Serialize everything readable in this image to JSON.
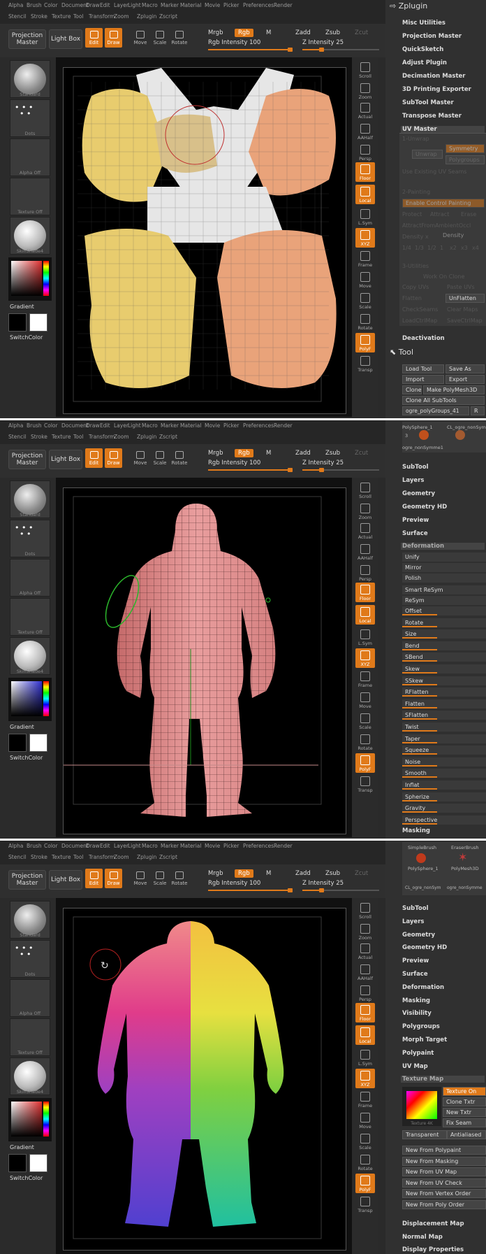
{
  "menu_row1": [
    "Alpha",
    "Brush",
    "Color",
    "Document",
    "Draw",
    "Edit",
    "Layer",
    "Light",
    "Macro",
    "Marker",
    "Material",
    "Movie",
    "Picker",
    "Preferences",
    "Render"
  ],
  "menu_row2": [
    "Stencil",
    "Stroke",
    "Texture",
    "Tool",
    "Transform",
    "Zoom",
    "Zplugin",
    "Zscript"
  ],
  "topbar": {
    "projection_master": "Projection Master",
    "light_box": "Light Box",
    "edit": "Edit",
    "draw": "Draw",
    "move": "Move",
    "scale": "Scale",
    "rotate": "Rotate",
    "mrgb": "Mrgb",
    "rgb": "Rgb",
    "m": "M",
    "zadd": "Zadd",
    "zsub": "Zsub",
    "zcut": "Zcut",
    "rgb_intensity": "Rgb Intensity 100",
    "z_intensity": "Z Intensity 25",
    "rgb_intensity_level": 1.0,
    "z_intensity_level": 0.25
  },
  "left": {
    "standard": "Standard",
    "dots": "Dots",
    "alpha_off": "Alpha Off",
    "texture_off": "Texture Off",
    "material": "SkinShade4",
    "gradient": "Gradient",
    "switchcolor": "SwitchColor"
  },
  "shelf": [
    "Scroll",
    "Zoom",
    "Actual",
    "AAHalf",
    "Persp",
    "Floor",
    "Local",
    "L.Sym",
    "XYZ",
    "Frame",
    "Move",
    "Scale",
    "Rotate",
    "PolyF",
    "Transp"
  ],
  "panel1": {
    "header": "Zplugin",
    "items": [
      "Misc Utilities",
      "Projection Master",
      "QuickSketch",
      "Adjust Plugin",
      "Decimation Master",
      "3D Printing Exporter",
      "SubTool Master",
      "Transpose Master",
      "UV Master"
    ],
    "uv": {
      "unwrap_hdr": "1-Unwrap",
      "unwrap": "Unwrap",
      "symmetry": "Symmetry",
      "polygroups": "Polygroups",
      "use_existing": "Use Existing UV Seams",
      "painting_hdr": "2-Painting",
      "enable_painting": "Enable Control Painting",
      "protect": "Protect",
      "attract": "Attract",
      "erase": "Erase",
      "attract_ambient": "AttractFromAmbientOccl",
      "density": "Density x",
      "density_slider": "Density",
      "density_vals": [
        "1/4",
        "1/3",
        "1/2",
        "1",
        "x2",
        "x3",
        "x4"
      ],
      "utilities_hdr": "3-Utilities",
      "work_on_clone": "Work On Clone",
      "copy_uvs": "Copy UVs",
      "paste_uvs": "Paste UVs",
      "flatten": "Flatten",
      "unflatten": "UnFlatten",
      "checkseams": "CheckSeams",
      "clear_maps": "Clear Maps",
      "loadctrlmap": "LoadCtrlMap",
      "savectrlmap": "SaveCtrlMap"
    },
    "deactivation": "Deactivation",
    "tool_hdr": "Tool",
    "load_tool": "Load Tool",
    "save_as": "Save As",
    "import": "Import",
    "export": "Export",
    "clone": "Clone",
    "make_polymesh": "Make PolyMesh3D",
    "clone_all": "Clone All SubTools",
    "current_tool": "ogre_polyGroups_41",
    "current_val": "R"
  },
  "panel2": {
    "thumbs": [
      "PolySphere_1",
      "CL_ogre_nonSym",
      "3",
      "ogre_nonSymme1"
    ],
    "items": [
      "SubTool",
      "Layers",
      "Geometry",
      "Geometry HD",
      "Preview",
      "Surface"
    ],
    "deformation_hdr": "Deformation",
    "unify": "Unify",
    "mirror": "Mirror",
    "polish": "Polish",
    "smart_resym": "Smart ReSym",
    "resym": "ReSym",
    "deforms": [
      "Offset",
      "Rotate",
      "Size",
      "Bend",
      "SBend",
      "Skew",
      "SSkew",
      "RFlatten",
      "Flatten",
      "SFlatten",
      "Twist",
      "Taper",
      "Squeeze",
      "Noise",
      "Smooth",
      "Inflat",
      "Spherize",
      "Gravity",
      "Perspective"
    ],
    "masking": "Masking"
  },
  "panel3": {
    "thumbs": [
      "SimpleBrush",
      "EraserBrush",
      "PolySphere_1",
      "PolyMesh3D",
      "CL_ogre_nonSym",
      "ogre_nonSymme"
    ],
    "items": [
      "SubTool",
      "Layers",
      "Geometry",
      "Geometry HD",
      "Preview",
      "Surface",
      "Deformation",
      "Masking",
      "Visibility",
      "Polygroups",
      "Morph Target",
      "Polypaint",
      "UV Map"
    ],
    "texture_map_hdr": "Texture Map",
    "texture_on": "Texture On",
    "clone_txtr": "Clone Txtr",
    "new_txtr": "New Txtr",
    "fix_seam": "Fix Seam",
    "texture_label": "Texture 4K",
    "transparent": "Transparent",
    "antialiased": "Antialiased",
    "new_from": [
      "New From Polypaint",
      "New From Masking",
      "New From UV Map",
      "New From UV Check",
      "New From Vertex Order",
      "New From Poly Order"
    ],
    "after": [
      "Displacement Map",
      "Normal Map",
      "Display Properties"
    ]
  },
  "colors": {
    "accent": "#e07a1a",
    "ui_bg": "#2a2a2a",
    "panel_bg": "#303030"
  }
}
